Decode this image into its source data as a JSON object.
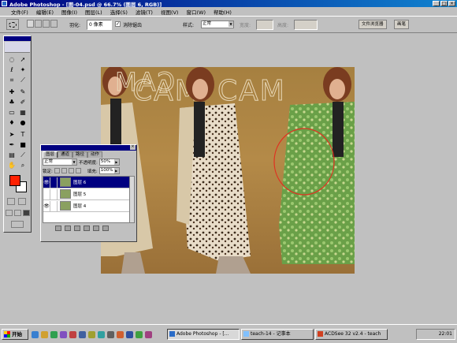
{
  "window": {
    "title": "Adobe Photoshop - [图-04.psd @ 66.7% (图层 6, RGB)]",
    "controls": [
      "_",
      "□",
      "×"
    ]
  },
  "menu": [
    "文件(F)",
    "编辑(E)",
    "图像(I)",
    "图层(L)",
    "选择(S)",
    "滤镜(T)",
    "视图(V)",
    "窗口(W)",
    "帮助(H)"
  ],
  "options": {
    "feather_label": "羽化:",
    "feather_value": "0 像素",
    "antialias_label": "消除锯齿",
    "style_label": "样式:",
    "style_value": "正常",
    "width_label": "宽度:",
    "height_label": "高度:",
    "palette_tabs": [
      "文件浏览器",
      "画笔"
    ]
  },
  "layers_panel": {
    "tabs": [
      "图层",
      "通道",
      "路径",
      "动作"
    ],
    "blend_mode": "正常",
    "opacity_label": "不透明度:",
    "opacity_value": "50%",
    "lock_label": "锁定:",
    "fill_label": "填充:",
    "fill_value": "100%",
    "layers": [
      {
        "name": "图层 6",
        "visible": true,
        "selected": true
      },
      {
        "name": "图层 5",
        "visible": false,
        "selected": false
      },
      {
        "name": "图层 4",
        "visible": true,
        "selected": false
      }
    ]
  },
  "canvas": {
    "text_left": "CAM",
    "text_right": "CAM"
  },
  "taskbar": {
    "start": "开始",
    "tasks": [
      "Adobe Photoshop - [...",
      "teach-14 - 记事本",
      "ACDSee 32 v2.4 - teach"
    ],
    "clock": "22:01"
  },
  "colors": {
    "foreground": "#ff2000",
    "background": "#ffffff",
    "selection": "#000080",
    "annotation_ellipse": "#e03020"
  }
}
